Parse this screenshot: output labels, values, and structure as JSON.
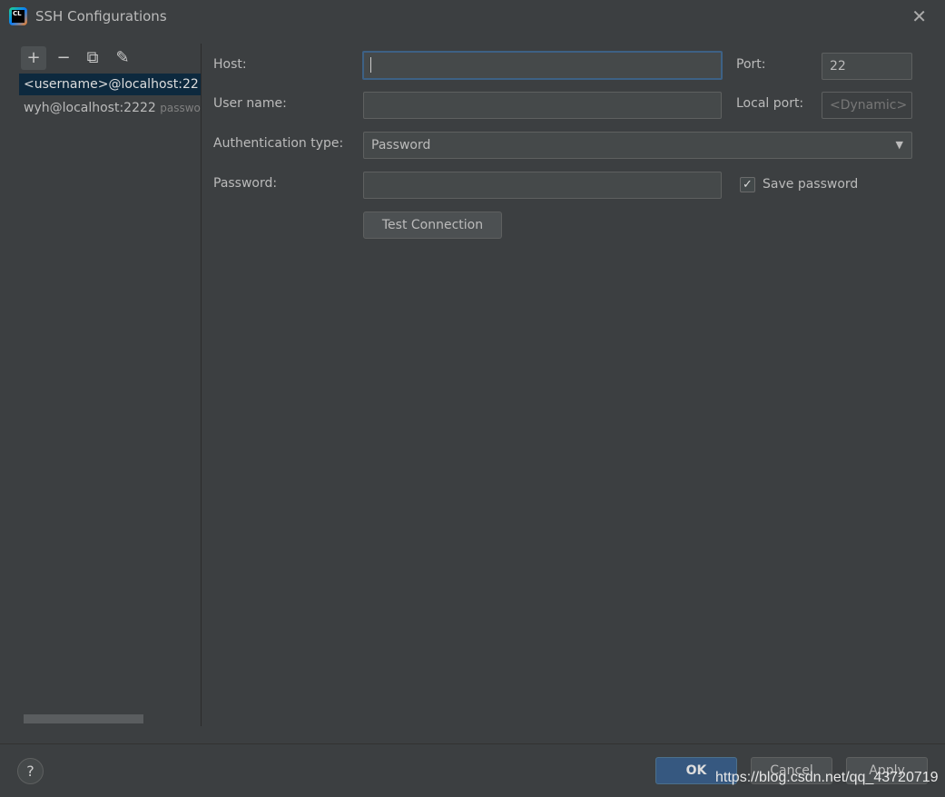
{
  "window": {
    "title": "SSH Configurations",
    "logo_text": "CL"
  },
  "toolbar": {
    "add": "+",
    "remove": "−",
    "copy": "⧉",
    "edit": "✎"
  },
  "list": [
    {
      "label": "<username>@localhost:22",
      "hint": ""
    },
    {
      "label": "wyh@localhost:2222",
      "hint": "password"
    }
  ],
  "form": {
    "host_label": "Host:",
    "host_value": "",
    "port_label": "Port:",
    "port_value": "22",
    "username_label": "User name:",
    "username_value": "",
    "local_port_label": "Local port:",
    "local_port_value": "<Dynamic>",
    "auth_label": "Authentication type:",
    "auth_value": "Password",
    "password_label": "Password:",
    "password_value": "",
    "save_password_label": "Save password",
    "save_password_checked": true,
    "test_connection": "Test Connection"
  },
  "footer": {
    "help": "?",
    "ok": "OK",
    "cancel": "Cancel",
    "apply": "Apply"
  },
  "watermark": "https://blog.csdn.net/qq_43720719"
}
